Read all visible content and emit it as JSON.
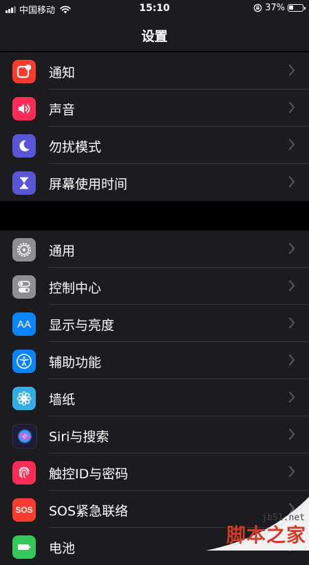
{
  "status_bar": {
    "carrier": "中国移动",
    "time": "15:10",
    "battery_percent": "37%",
    "battery_level": 0.37
  },
  "nav": {
    "title": "设置"
  },
  "groups": [
    {
      "items": [
        {
          "label": "通知",
          "icon": "notifications-icon",
          "color": "#ff3b30"
        },
        {
          "label": "声音",
          "icon": "sound-icon",
          "color": "#ff2d55"
        },
        {
          "label": "勿扰模式",
          "icon": "moon-icon",
          "color": "#5856d6"
        },
        {
          "label": "屏幕使用时间",
          "icon": "hourglass-icon",
          "color": "#5856d6"
        }
      ]
    },
    {
      "items": [
        {
          "label": "通用",
          "icon": "gear-icon",
          "color": "#8e8e93"
        },
        {
          "label": "控制中心",
          "icon": "toggles-icon",
          "color": "#8e8e93"
        },
        {
          "label": "显示与亮度",
          "icon": "text-size-icon",
          "color": "#0a84ff"
        },
        {
          "label": "辅助功能",
          "icon": "accessibility-icon",
          "color": "#0a84ff"
        },
        {
          "label": "墙纸",
          "icon": "flower-icon",
          "color": "#32ade6"
        },
        {
          "label": "Siri与搜索",
          "icon": "siri-icon",
          "color": "#1c1c3a"
        },
        {
          "label": "触控ID与密码",
          "icon": "fingerprint-icon",
          "color": "#ff2d55"
        },
        {
          "label": "SOS紧急联络",
          "icon": "sos-icon",
          "color": "#ff3b30"
        },
        {
          "label": "电池",
          "icon": "battery-icon",
          "color": "#34c759"
        }
      ]
    }
  ],
  "sos_icon_text": "SOS",
  "text_size_icon_text": "AA",
  "watermark": {
    "url": "jb51.net",
    "text": "脚本之家"
  }
}
